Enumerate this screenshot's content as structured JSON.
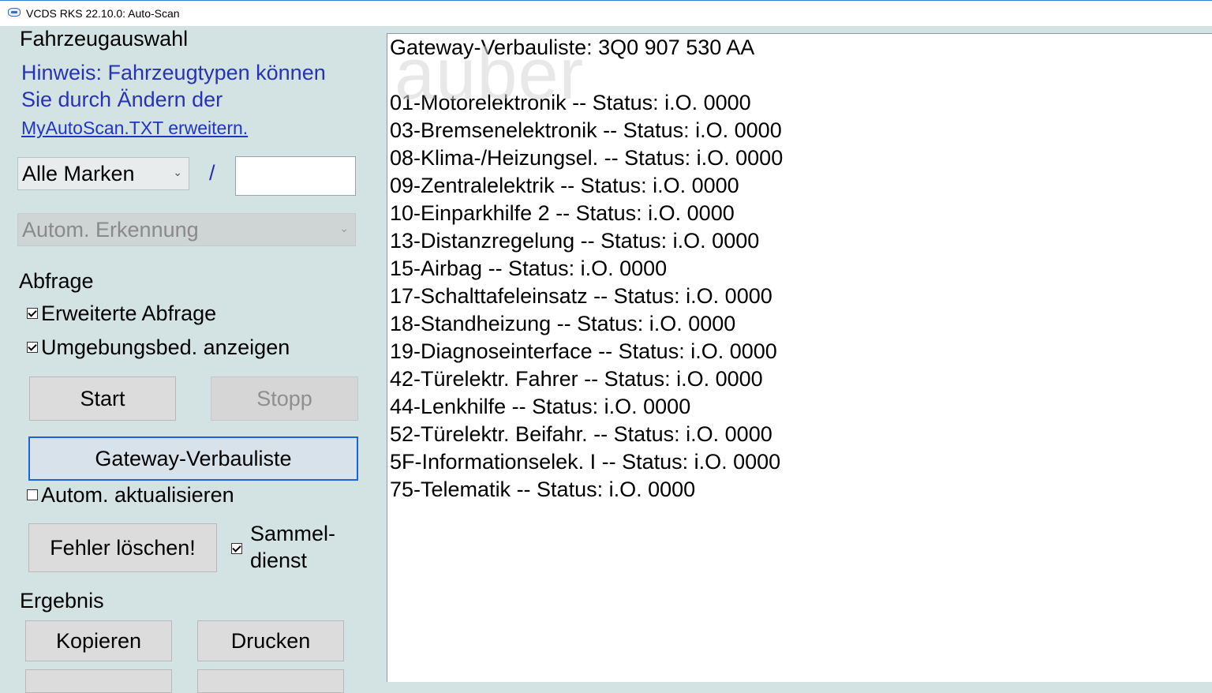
{
  "window": {
    "title": "VCDS RKS 22.10.0:  Auto-Scan"
  },
  "left": {
    "vehicle_heading": "Fahrzeugauswahl",
    "hint_line1": "Hinweis: Fahrzeugtypen können",
    "hint_line2": "Sie durch Ändern der",
    "hint_link": "MyAutoScan.TXT erweitern.",
    "brand_select": "Alle Marken",
    "slash": "/",
    "model_input": "",
    "detect_select": "Autom. Erkennung",
    "query_heading": "Abfrage",
    "extended_query": {
      "label": "Erweiterte Abfrage",
      "checked": true
    },
    "show_env": {
      "label": "Umgebungsbed. anzeigen",
      "checked": true
    },
    "start_button": "Start",
    "stop_button": "Stopp",
    "gateway_button": "Gateway-Verbauliste",
    "auto_update": {
      "label": "Autom. aktualisieren",
      "checked": false
    },
    "clear_button": "Fehler löschen!",
    "collective_line1": "Sammel-",
    "collective_line2": "dienst",
    "collective_checked": true,
    "result_heading": "Ergebnis",
    "copy_button": "Kopieren",
    "print_button": "Drucken"
  },
  "results": {
    "header": "Gateway-Verbauliste:  3Q0 907 530 AA",
    "watermark": "auber",
    "lines": [
      "01-Motorelektronik -- Status: i.O. 0000",
      "03-Bremsenelektronik -- Status: i.O. 0000",
      "08-Klima-/Heizungsel. -- Status: i.O. 0000",
      "09-Zentralelektrik -- Status: i.O. 0000",
      "10-Einparkhilfe 2 -- Status: i.O. 0000",
      "13-Distanzregelung -- Status: i.O. 0000",
      "15-Airbag -- Status: i.O. 0000",
      "17-Schalttafeleinsatz -- Status: i.O. 0000",
      "18-Standheizung -- Status: i.O. 0000",
      "19-Diagnoseinterface -- Status: i.O. 0000",
      "42-Türelektr. Fahrer -- Status: i.O. 0000",
      "44-Lenkhilfe -- Status: i.O. 0000",
      "52-Türelektr. Beifahr. -- Status: i.O. 0000",
      "5F-Informationselek. I -- Status: i.O. 0000",
      "75-Telematik -- Status: i.O. 0000"
    ]
  }
}
